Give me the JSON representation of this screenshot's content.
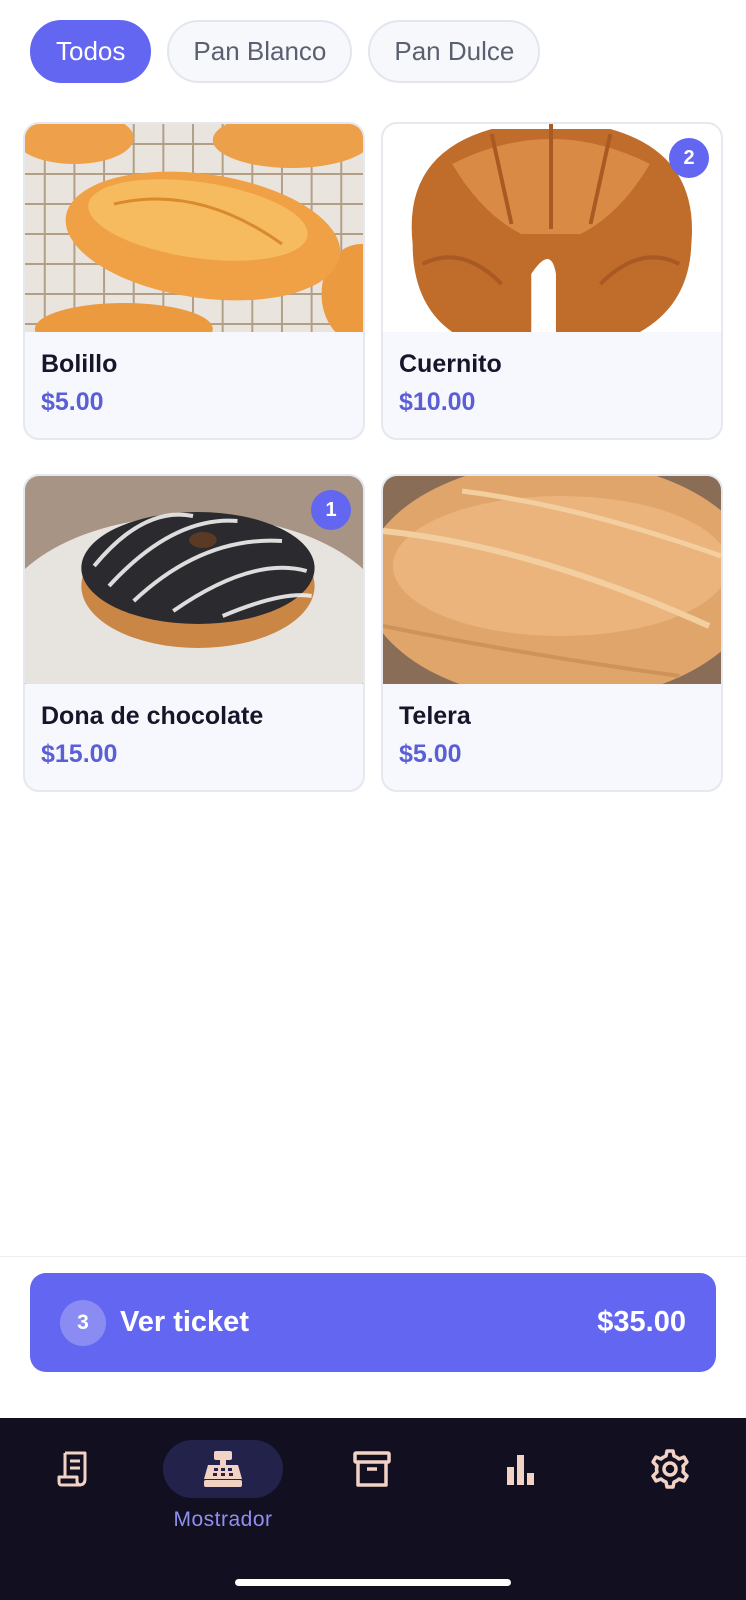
{
  "categories": {
    "items": [
      {
        "label": "Todos",
        "active": true
      },
      {
        "label": "Pan Blanco",
        "active": false
      },
      {
        "label": "Pan Dulce",
        "active": false
      }
    ]
  },
  "products": [
    {
      "name": "Bolillo",
      "price": "$5.00",
      "qty": null,
      "image": "bolillo-image"
    },
    {
      "name": "Cuernito",
      "price": "$10.00",
      "qty": "2",
      "image": "croissant-image"
    },
    {
      "name": "Dona de chocolate",
      "price": "$15.00",
      "qty": "1",
      "image": "chocolate-donut-image"
    },
    {
      "name": "Telera",
      "price": "$5.00",
      "qty": null,
      "image": "telera-image"
    }
  ],
  "ticket": {
    "count": "3",
    "label": "Ver ticket",
    "total": "$35.00"
  },
  "nav": {
    "items": [
      {
        "icon": "receipt-icon",
        "label": ""
      },
      {
        "icon": "cash-register-icon",
        "label": "Mostrador",
        "active": true
      },
      {
        "icon": "archive-box-icon",
        "label": ""
      },
      {
        "icon": "bar-chart-icon",
        "label": ""
      },
      {
        "icon": "gear-icon",
        "label": ""
      }
    ]
  },
  "colors": {
    "accent": "#6366f1",
    "price": "#5b5fd6",
    "nav_background": "#110f20",
    "nav_icon": "#f2d2c4"
  }
}
